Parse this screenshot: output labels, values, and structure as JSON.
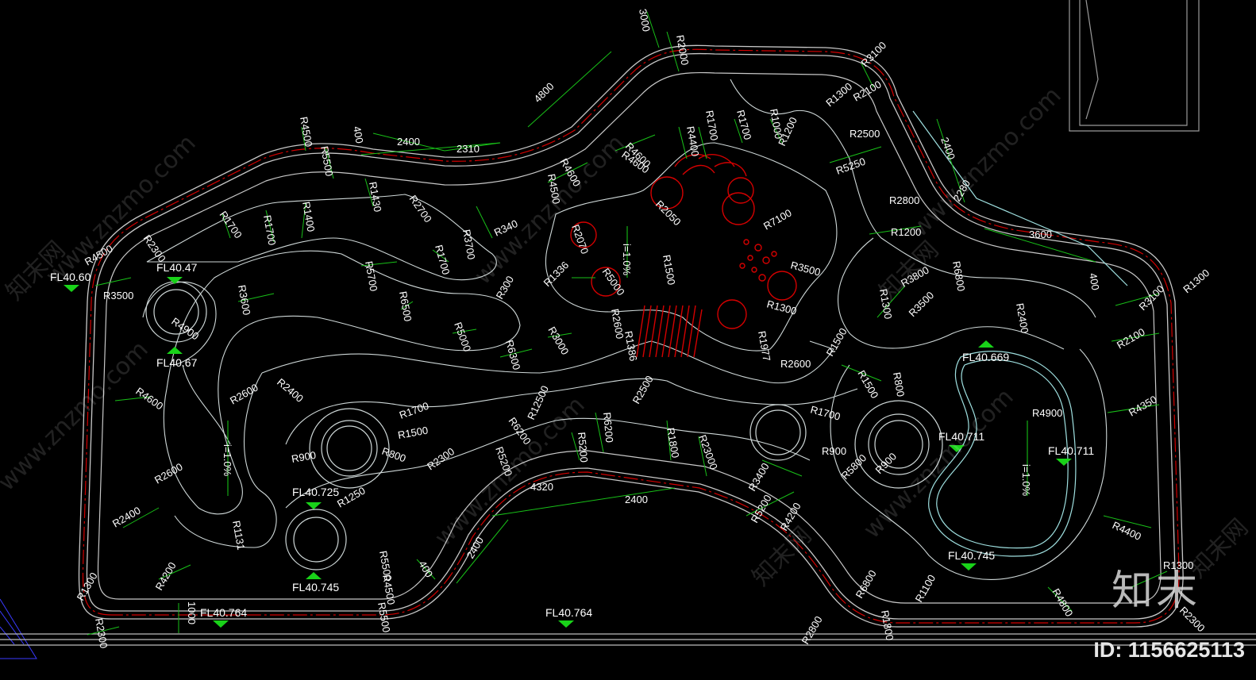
{
  "levels": {
    "fl1": "FL40.60",
    "fl2": "FL40.47",
    "fl3": "FL40.67",
    "fl4": "FL40.764",
    "fl5": "FL40.764",
    "fl6": "FL40.725",
    "fl7": "FL40.745",
    "fl8": "FL40.669",
    "fl9": "FL40.711",
    "fl10": "FL40.711",
    "fl11": "FL40.745"
  },
  "dims": {
    "d3000": "3000",
    "d4800": "4800",
    "d2400a": "2400",
    "d2310": "2310",
    "d400a": "400",
    "d2400b": "2400",
    "d2280": "2280",
    "d3600": "3600",
    "d400b": "400",
    "d4320": "4320",
    "d2400c": "2400",
    "d2400d": "2400",
    "d400c": "400",
    "d1000": "1000"
  },
  "radii": {
    "r1": "R2000",
    "r2": "R3100",
    "r3": "R4500",
    "r4": "R5500",
    "r5": "R1430",
    "r6": "R2700",
    "r7": "R3700",
    "r8": "R1700",
    "r9": "R1400",
    "r10": "R1700",
    "r11": "R2300",
    "r12": "R4500",
    "r13": "R3500",
    "r14": "R4900",
    "r15": "R3600",
    "r16": "R5700",
    "r17": "R6500",
    "r18": "R5000",
    "r19": "R4600",
    "r20": "R2600",
    "r21": "R2400",
    "r22": "R2600",
    "r23": "R2400",
    "r24": "R1131",
    "r25": "R900",
    "r26": "R800",
    "r27": "R1250",
    "r28": "R1500",
    "r29": "R1700",
    "r30": "R2300",
    "r31": "R6300",
    "r32": "R3000",
    "r33": "R12500",
    "r34": "R6200",
    "r35": "R5200",
    "r36": "R6200",
    "r37": "R5200",
    "r38": "R1800",
    "r39": "R23000",
    "r40": "R4500",
    "r41": "R5500",
    "r42": "R4500",
    "r43": "R1300",
    "r44": "R2300",
    "r45": "R4200",
    "r46": "R4600",
    "r47": "R1700",
    "r48": "R340",
    "r49": "R300",
    "r50": "R2070",
    "r51": "R1336",
    "r52": "R5000",
    "r53": "R2600",
    "r54": "R1386",
    "r55": "R2500",
    "r56": "R1500",
    "r57": "R2050",
    "r58": "R4400",
    "r59": "R4600",
    "r60": "R1700",
    "r61": "R4600",
    "r62": "R1700",
    "r63": "R1000",
    "r64": "R1200",
    "r65": "R7100",
    "r66": "R3500",
    "r67": "R1300",
    "r68": "R1977",
    "r69": "R2600",
    "r70": "R1300",
    "r71": "R2100",
    "r72": "R2500",
    "r73": "R5250",
    "r74": "R2800",
    "r75": "R1200",
    "r76": "R3800",
    "r77": "R6800",
    "r78": "R1300",
    "r79": "R3500",
    "r80": "R1500",
    "r81": "R1700",
    "r82": "R1500",
    "r83": "R800",
    "r84": "R2400",
    "r85": "R3100",
    "r86": "R2100",
    "r87": "R4900",
    "r88": "R4350",
    "r89": "R900",
    "r90": "R5800",
    "r91": "R900",
    "r92": "R3400",
    "r93": "R5200",
    "r94": "R4200",
    "r95": "R4400",
    "r96": "R1300",
    "r97": "R2300",
    "r98": "R4800",
    "r99": "R1100",
    "r100": "R6800",
    "r101": "R1800",
    "r102": "R2800",
    "r103": "R5500",
    "r104": "R1300"
  },
  "slopes": {
    "s1": "i=1.0%",
    "s2": "i=1.0%",
    "s3": "i=1.0%"
  },
  "watermark": {
    "text": "www.znzmo.com",
    "brand": "知末",
    "brand_small": "知末网"
  },
  "id_text": "ID: 1156625113",
  "colors": {
    "background": "#000000",
    "wall": "#c8c8c8",
    "red_line": "#d40000",
    "dim_line": "#18c018",
    "marker": "#19d219",
    "contour": "#cfd8d8",
    "cyan": "#9fe0e0"
  }
}
